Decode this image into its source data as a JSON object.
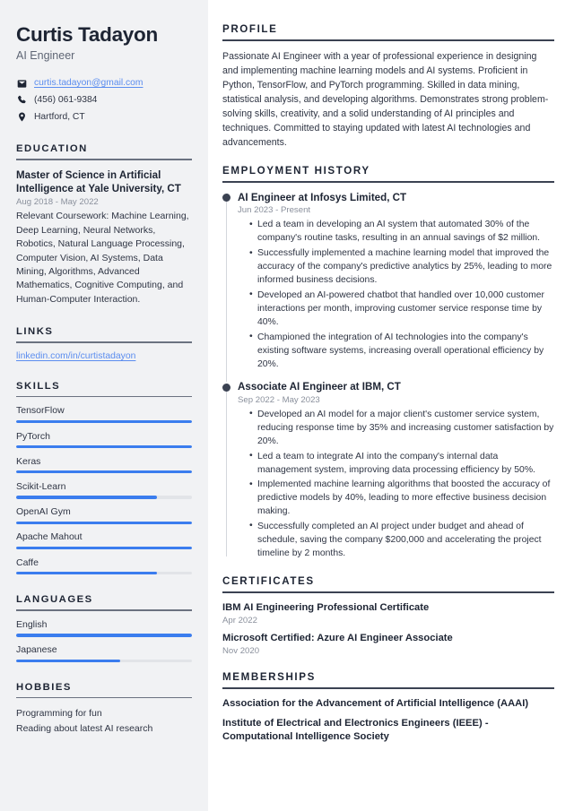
{
  "sidebar": {
    "name": "Curtis Tadayon",
    "job_title": "AI Engineer",
    "contact": [
      {
        "icon": "envelope-icon",
        "value": "curtis.tadayon@gmail.com",
        "is_link": true
      },
      {
        "icon": "phone-icon",
        "value": "(456) 061-9384",
        "is_link": false
      },
      {
        "icon": "location-pin-icon",
        "value": "Hartford, CT",
        "is_link": false
      }
    ],
    "education": {
      "heading": "EDUCATION",
      "degree": "Master of Science in Artificial Intelligence at Yale University, CT",
      "date": "Aug 2018 - May 2022",
      "description": "Relevant Coursework: Machine Learning, Deep Learning, Neural Networks, Robotics, Natural Language Processing, Computer Vision, AI Systems, Data Mining, Algorithms, Advanced Mathematics, Cognitive Computing, and Human-Computer Interaction."
    },
    "links": {
      "heading": "LINKS",
      "items": [
        {
          "label": "linkedin.com/in/curtistadayon"
        }
      ]
    },
    "skills": {
      "heading": "SKILLS",
      "items": [
        {
          "label": "TensorFlow",
          "level": 100
        },
        {
          "label": "PyTorch",
          "level": 100
        },
        {
          "label": "Keras",
          "level": 100
        },
        {
          "label": "Scikit-Learn",
          "level": 80
        },
        {
          "label": "OpenAI Gym",
          "level": 100
        },
        {
          "label": "Apache Mahout",
          "level": 100
        },
        {
          "label": "Caffe",
          "level": 80
        }
      ]
    },
    "languages": {
      "heading": "LANGUAGES",
      "items": [
        {
          "label": "English",
          "level": 100
        },
        {
          "label": "Japanese",
          "level": 59
        }
      ]
    },
    "hobbies": {
      "heading": "HOBBIES",
      "items": [
        {
          "label": "Programming for fun"
        },
        {
          "label": "Reading about latest AI research"
        }
      ]
    }
  },
  "main": {
    "profile": {
      "heading": "PROFILE",
      "text": "Passionate AI Engineer with a year of professional experience in designing and implementing machine learning models and AI systems. Proficient in Python, TensorFlow, and PyTorch programming. Skilled in data mining, statistical analysis, and developing algorithms. Demonstrates strong problem-solving skills, creativity, and a solid understanding of AI principles and techniques. Committed to staying updated with latest AI technologies and advancements."
    },
    "employment": {
      "heading": "EMPLOYMENT HISTORY",
      "entries": [
        {
          "title": "AI Engineer at Infosys Limited, CT",
          "date": "Jun 2023 - Present",
          "bullets": [
            "Led a team in developing an AI system that automated 30% of the company's routine tasks, resulting in an annual savings of $2 million.",
            "Successfully implemented a machine learning model that improved the accuracy of the company's predictive analytics by 25%, leading to more informed business decisions.",
            "Developed an AI-powered chatbot that handled over 10,000 customer interactions per month, improving customer service response time by 40%.",
            "Championed the integration of AI technologies into the company's existing software systems, increasing overall operational efficiency by 20%."
          ]
        },
        {
          "title": "Associate AI Engineer at IBM, CT",
          "date": "Sep 2022 - May 2023",
          "bullets": [
            "Developed an AI model for a major client's customer service system, reducing response time by 35% and increasing customer satisfaction by 20%.",
            "Led a team to integrate AI into the company's internal data management system, improving data processing efficiency by 50%.",
            "Implemented machine learning algorithms that boosted the accuracy of predictive models by 40%, leading to more effective business decision making.",
            "Successfully completed an AI project under budget and ahead of schedule, saving the company $200,000 and accelerating the project timeline by 2 months."
          ]
        }
      ]
    },
    "certificates": {
      "heading": "CERTIFICATES",
      "items": [
        {
          "name": "IBM AI Engineering Professional Certificate",
          "date": "Apr 2022"
        },
        {
          "name": "Microsoft Certified: Azure AI Engineer Associate",
          "date": "Nov 2020"
        }
      ]
    },
    "memberships": {
      "heading": "MEMBERSHIPS",
      "items": [
        {
          "name": "Association for the Advancement of Artificial Intelligence (AAAI)"
        },
        {
          "name": "Institute of Electrical and Electronics Engineers (IEEE) - Computational Intelligence Society"
        }
      ]
    }
  },
  "colors": {
    "sidebar_bg": "#f1f2f4",
    "accent_bar": "#3b7dee",
    "link": "#5b8def",
    "heading": "#1d2433",
    "body_text": "#2e3443",
    "muted_text": "#8a909c"
  }
}
